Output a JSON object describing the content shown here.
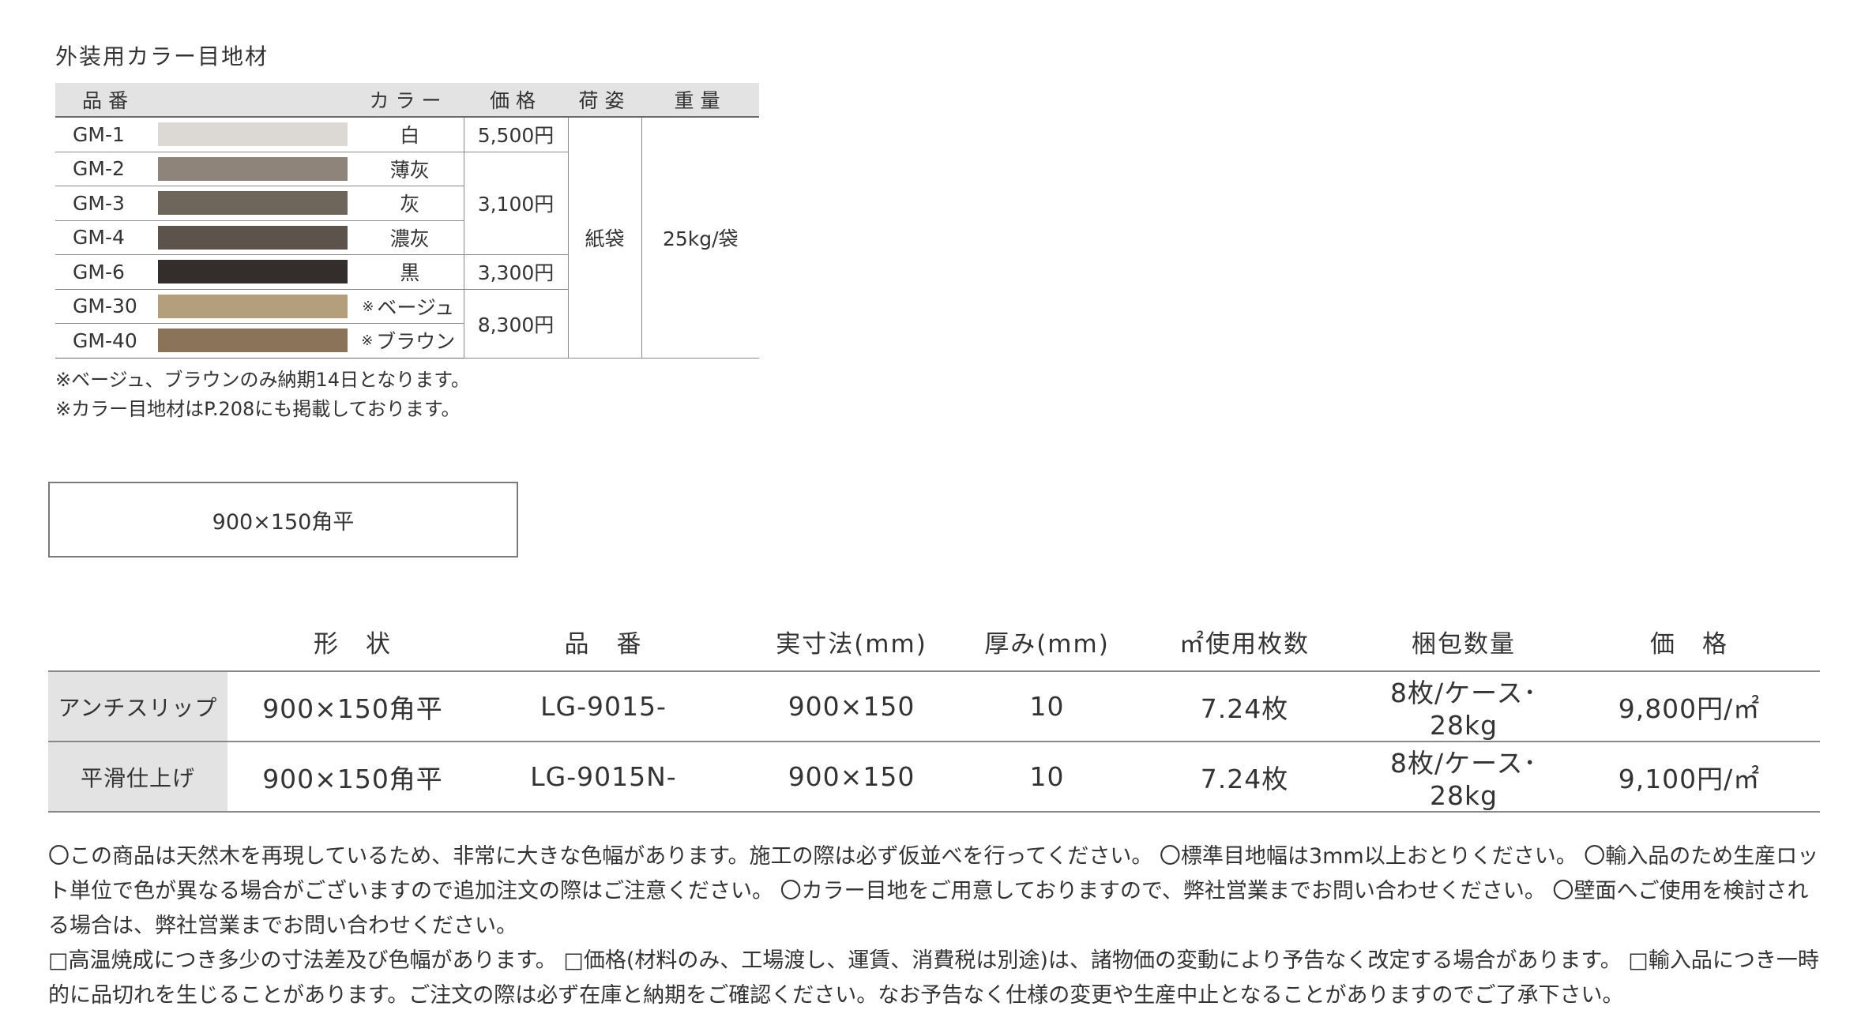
{
  "grout": {
    "title": "外装用カラー目地材",
    "headers": {
      "code": "品番",
      "color": "カラー",
      "price": "価格",
      "package": "荷姿",
      "weight": "重量"
    },
    "rows": [
      {
        "code": "GM-1",
        "swatch": "#dcd9d4",
        "color_mark": "",
        "color": "白"
      },
      {
        "code": "GM-2",
        "swatch": "#8e8479",
        "color_mark": "",
        "color": "薄灰"
      },
      {
        "code": "GM-3",
        "swatch": "#6e655b",
        "color_mark": "",
        "color": "灰"
      },
      {
        "code": "GM-4",
        "swatch": "#5c544c",
        "color_mark": "",
        "color": "濃灰"
      },
      {
        "code": "GM-6",
        "swatch": "#332e2b",
        "color_mark": "",
        "color": "黒"
      },
      {
        "code": "GM-30",
        "swatch": "#b39f7c",
        "color_mark": "※",
        "color": "ベージュ"
      },
      {
        "code": "GM-40",
        "swatch": "#8b735a",
        "color_mark": "※",
        "color": "ブラウン"
      }
    ],
    "prices": [
      "5,500円",
      "3,100円",
      "3,300円",
      "8,300円"
    ],
    "package": "紙袋",
    "weight": "25kg/袋",
    "notes": [
      "※ベージュ、ブラウンのみ納期14日となります。",
      "※カラー目地材はP.208にも掲載しております。"
    ]
  },
  "product_label": "900×150角平",
  "spec": {
    "headers": [
      "",
      "形　状",
      "品　番",
      "実寸法(mm)",
      "厚み(mm)",
      "㎡使用枚数",
      "梱包数量",
      "価　格"
    ],
    "rows": [
      {
        "finish": "アンチスリップ",
        "shape": "900×150角平",
        "code": "LG-9015-",
        "size": "900×150",
        "thickness": "10",
        "per_m2": "7.24枚",
        "pack": "8枚/ケース･28kg",
        "price": "9,800円/㎡"
      },
      {
        "finish": "平滑仕上げ",
        "shape": "900×150角平",
        "code": "LG-9015N-",
        "size": "900×150",
        "thickness": "10",
        "per_m2": "7.24枚",
        "pack": "8枚/ケース･28kg",
        "price": "9,100円/㎡"
      }
    ]
  },
  "notes": [
    "〇この商品は天然木を再現しているため、非常に大きな色幅があります。施工の際は必ず仮並べを行ってください。 〇標準目地幅は3mm以上おとりください。 〇輸入品のため生産ロット単位で色が異なる場合がございますので追加注文の際はご注意ください。 〇カラー目地をご用意しておりますので、弊社営業までお問い合わせください。 〇壁面へご使用を検討される場合は、弊社営業までお問い合わせください。",
    "□高温焼成につき多少の寸法差及び色幅があります。 □価格(材料のみ、工場渡し、運賃、消費税は別途)は、諸物価の変動により予告なく改定する場合があります。 □輸入品につき一時的に品切れを生じることがあります。ご注文の際は必ず在庫と納期をご確認ください。なお予告なく仕様の変更や生産中止となることがありますのでご了承下さい。"
  ]
}
